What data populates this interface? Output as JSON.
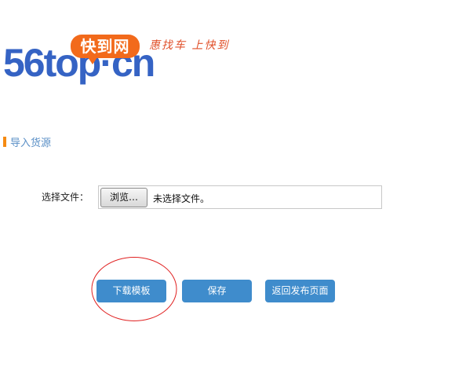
{
  "logo": {
    "brand": "56top·cn",
    "bubble": "快到网",
    "slogan": "惠找车 上快到"
  },
  "section_title": "导入货源",
  "form": {
    "file_label": "选择文件：",
    "browse_label": "浏览…",
    "file_status": "未选择文件。"
  },
  "buttons": {
    "download_template": "下载模板",
    "save": "保存",
    "back": "返回发布页面"
  },
  "colors": {
    "accent": "#3f8ccc",
    "heading": "#5a8fc6",
    "marker": "#f58a12",
    "annotation": "#e02020"
  }
}
